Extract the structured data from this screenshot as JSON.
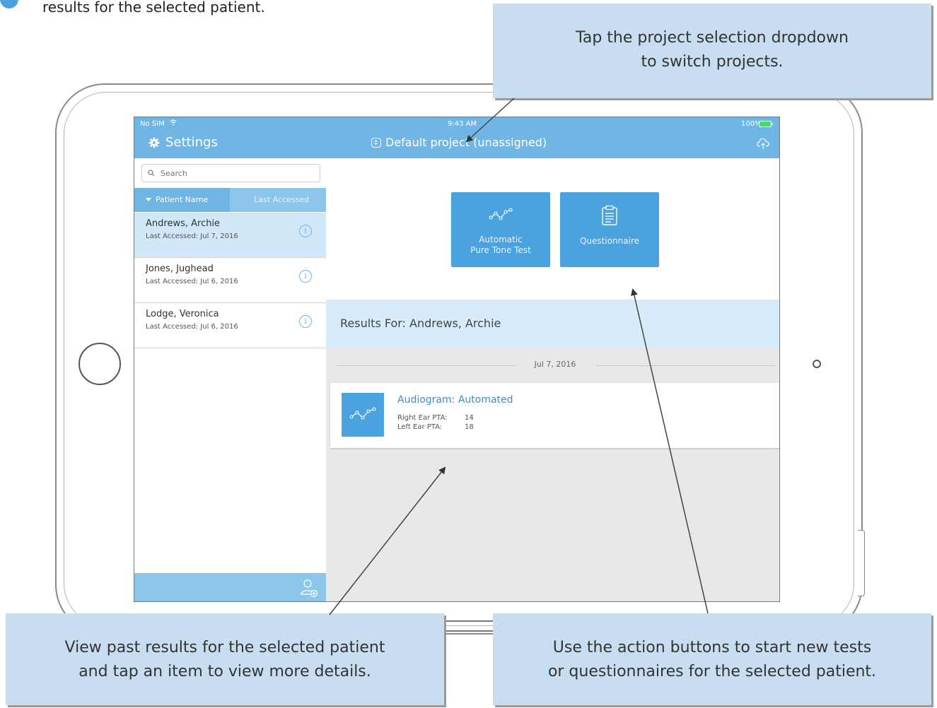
{
  "intro_text": "results for the selected patient.",
  "status_bar": {
    "carrier": "No SIM",
    "time": "9:43 AM",
    "battery": "100%"
  },
  "nav": {
    "settings_label": "Settings",
    "project_label": "Default project (unassigned)"
  },
  "sidebar": {
    "search_placeholder": "Search",
    "sort_active": "Patient Name",
    "sort_inactive": "Last Accessed",
    "patients": [
      {
        "name": "Andrews, Archie",
        "accessed": "Last Accessed: Jul 7, 2016"
      },
      {
        "name": "Jones, Jughead",
        "accessed": "Last Accessed: Jul 6, 2016"
      },
      {
        "name": "Lodge, Veronica",
        "accessed": "Last Accessed: Jul 6, 2016"
      }
    ]
  },
  "actions": {
    "pure_tone_line1": "Automatic",
    "pure_tone_line2": "Pure Tone Test",
    "questionnaire": "Questionnaire"
  },
  "results": {
    "title": "Results For: Andrews, Archie",
    "date": "Jul 7, 2016",
    "card": {
      "title": "Audiogram: Automated",
      "right_label": "Right Ear PTA:",
      "right_value": "14",
      "left_label": "Left Ear PTA:",
      "left_value": "18"
    }
  },
  "callouts": {
    "top_line1": "Tap the project selection dropdown",
    "top_line2": "to switch projects.",
    "bottom_left_line1": "View past results for the selected patient",
    "bottom_left_line2": "and tap an item to view more details.",
    "bottom_right_line1": "Use the action buttons to start new tests",
    "bottom_right_line2": "or questionnaires for the selected patient."
  },
  "colors": {
    "accent": "#4aa3df",
    "nav": "#6fb6e4",
    "callout": "#c9ddf1"
  }
}
